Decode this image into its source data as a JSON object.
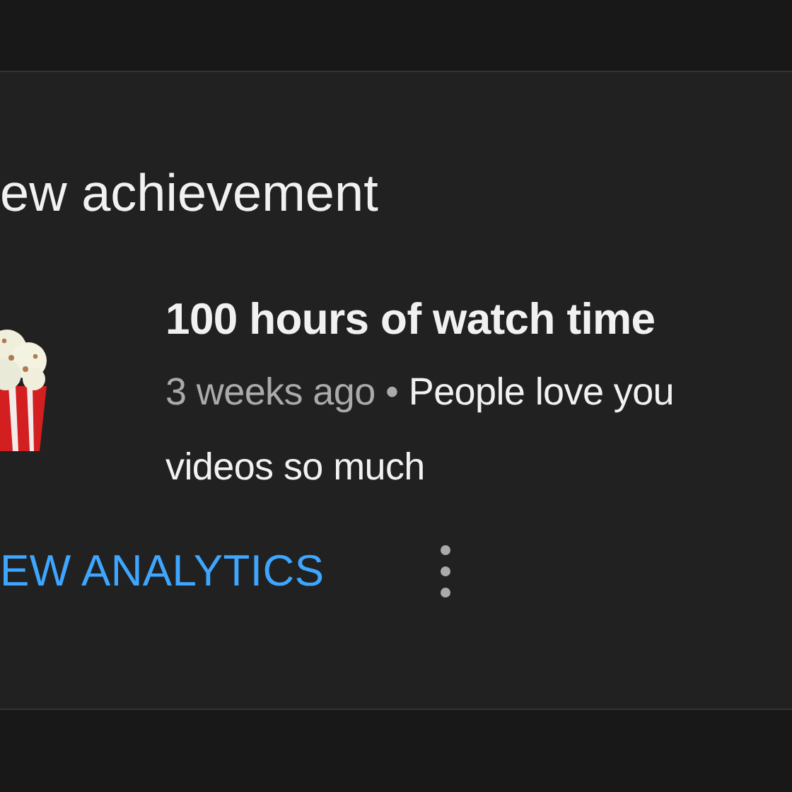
{
  "card": {
    "heading": "ew achievement",
    "title": "100 hours of watch time",
    "time": "3 weeks ago",
    "separator": "•",
    "message_lines": [
      "People love you",
      "videos so much"
    ],
    "action": "EW ANALYTICS"
  }
}
